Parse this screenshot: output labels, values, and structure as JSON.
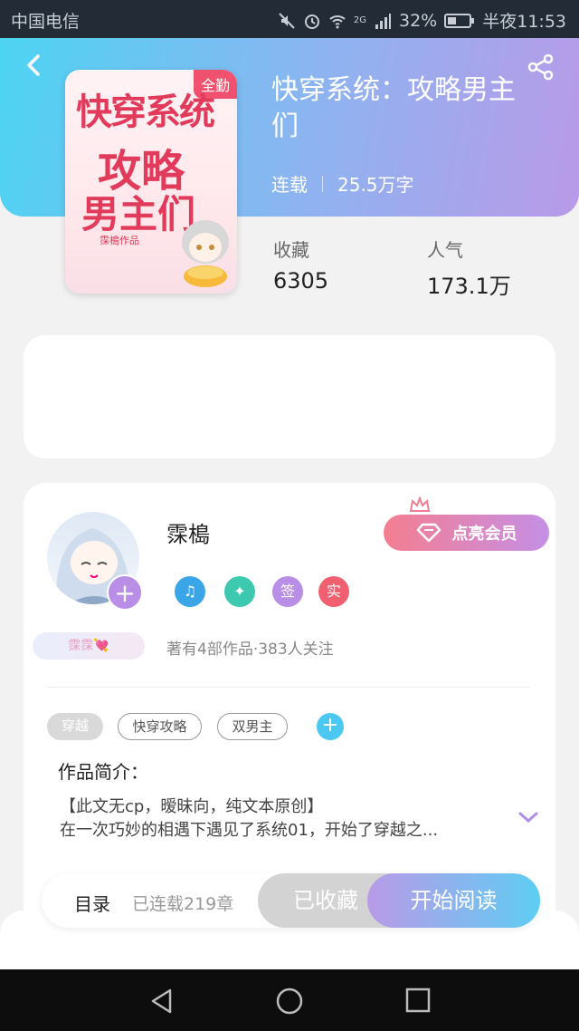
{
  "status_bar": {
    "carrier": "中国电信",
    "network": "2G",
    "battery": "32%",
    "time": "半夜11:53",
    "icons": [
      "mute-icon",
      "alarm-icon",
      "wifi-icon",
      "signal-icon",
      "battery-icon"
    ]
  },
  "header": {
    "back_icon": "back-arrow-icon",
    "share_icon": "share-icon",
    "colors": {
      "gradient_start": "#4dd4f3",
      "gradient_end": "#b99ae8"
    }
  },
  "book": {
    "cover_badge": "全勤",
    "cover_title_line1": "快穿系统",
    "cover_title_line2": "攻略",
    "cover_title_line3": "男主们",
    "cover_author": "霂槝作品",
    "title": "快穿系统：攻略男主们",
    "status": "连载",
    "word_count": "25.5万字",
    "stats": [
      {
        "label": "收藏",
        "value": "6305"
      },
      {
        "label": "人气",
        "value": "173.1万"
      }
    ]
  },
  "author": {
    "name": "霂槝",
    "name_tag": "霂霂💘",
    "vip_button": "点亮会员",
    "badges": [
      {
        "icon": "music-note-icon",
        "text": "♫",
        "color": "#3aa6e8"
      },
      {
        "icon": "handshake-icon",
        "text": "✦",
        "color": "#3cc9b0"
      },
      {
        "icon": "sign-icon",
        "text": "签",
        "color": "#b98ee6"
      },
      {
        "icon": "verified-icon",
        "text": "实",
        "color": "#f06070"
      }
    ],
    "works_info": "著有4部作品·383人关注"
  },
  "tags": [
    {
      "label": "穿越",
      "style": "filled"
    },
    {
      "label": "快穿攻略",
      "style": "outline"
    },
    {
      "label": "双男主",
      "style": "outline"
    }
  ],
  "intro": {
    "label": "作品简介：",
    "line1": "【此文无cp，暧昧向，纯文本原创】",
    "line2": "在一次巧妙的相遇下遇见了系统01，开始了穿越之..."
  },
  "action_bar": {
    "toc": "目录",
    "chapters": "已连载219章",
    "favorited": "已收藏",
    "start_reading": "开始阅读"
  },
  "nav_bar": {
    "icons": [
      "back-triangle-icon",
      "home-circle-icon",
      "recent-square-icon"
    ]
  }
}
